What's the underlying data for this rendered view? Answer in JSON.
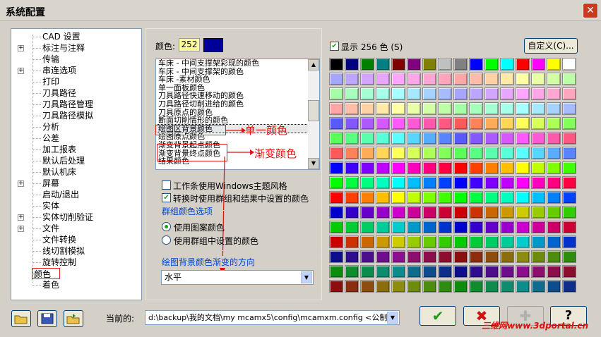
{
  "window": {
    "title": "系统配置",
    "close_glyph": "✕"
  },
  "tree": {
    "items": [
      {
        "label": "CAD 设置",
        "expandable": false
      },
      {
        "label": "标注与注释",
        "expandable": true
      },
      {
        "label": "传输",
        "expandable": false
      },
      {
        "label": "串连选项",
        "expandable": true
      },
      {
        "label": "打印",
        "expandable": false
      },
      {
        "label": "刀具路径",
        "expandable": false
      },
      {
        "label": "刀具路径管理",
        "expandable": false
      },
      {
        "label": "刀具路径模拟",
        "expandable": false
      },
      {
        "label": "分析",
        "expandable": false
      },
      {
        "label": "公差",
        "expandable": false
      },
      {
        "label": "加工报表",
        "expandable": false
      },
      {
        "label": "默认后处理",
        "expandable": false
      },
      {
        "label": "默认机床",
        "expandable": false
      },
      {
        "label": "屏幕",
        "expandable": true
      },
      {
        "label": "启动/退出",
        "expandable": false
      },
      {
        "label": "实体",
        "expandable": false
      },
      {
        "label": "实体切削验证",
        "expandable": true
      },
      {
        "label": "文件",
        "expandable": true
      },
      {
        "label": "文件转换",
        "expandable": false
      },
      {
        "label": "线切割模拟",
        "expandable": false
      },
      {
        "label": "旋转控制",
        "expandable": false
      },
      {
        "label": "颜色",
        "expandable": false,
        "selected": true
      },
      {
        "label": "着色",
        "expandable": false
      }
    ]
  },
  "color": {
    "label": "颜色:",
    "value": "252",
    "swatch": "#000099"
  },
  "color_list": {
    "items": [
      "车床 - 中间支撑架彩现的颜色",
      "车床 - 中间支撑架的颜色",
      "车床 -素材颜色",
      "单一面板颜色",
      "刀具路径快速移动的颜色",
      "刀具路径切削进给的颜色",
      "刀具原点的颜色",
      "断面切削情形的颜色",
      "绘图区背景颜色",
      "绘图原点颜色",
      "渐变背景起点颜色",
      "渐变背景终点颜色",
      "结果颜色"
    ],
    "selected_index": 8
  },
  "options": {
    "workbar_windows_theme": {
      "label": "工作条使用Windows主题风格",
      "checked": false
    },
    "convert_group_colors": {
      "label": "转换时使用群组和结果中设置的颜色",
      "checked": true
    }
  },
  "group_colors": {
    "title": "群组颜色选项",
    "opt1": "使用图案颜色",
    "opt2": "使用群组中设置的颜色",
    "selected": 1
  },
  "gradient": {
    "title": "绘图背景颜色渐变的方向",
    "value": "水平"
  },
  "palette": {
    "show_label": "显示 256 色 (S)",
    "show_checked": true,
    "custom_label": "自定义(C)..."
  },
  "annotations": {
    "single": "单一颜色",
    "gradient": "渐变颜色"
  },
  "footer": {
    "current_label": "当前的:",
    "path": "d:\\backup\\我的文档\\my mcamx5\\config\\mcamxm.config <公制>"
  },
  "buttons": {
    "ok": "✔",
    "cancel": "✖",
    "add": "✚",
    "help": "?"
  },
  "watermark": "三维网www.3dportal.cn"
}
